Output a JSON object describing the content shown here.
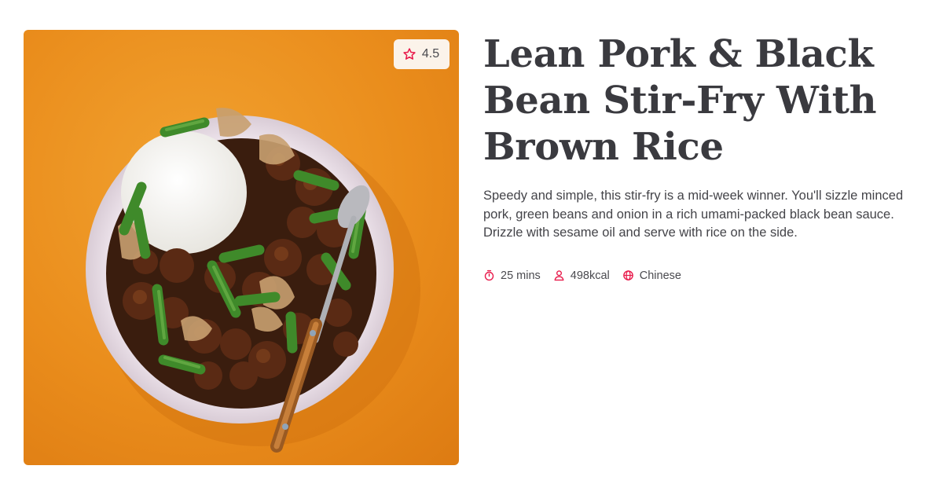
{
  "recipe": {
    "title": "Lean Pork & Black Bean Stir-Fry With Brown Rice",
    "description": "Speedy and simple, this stir-fry is a mid-week winner. You'll sizzle minced pork, green beans and onion in a rich umami-packed black bean sauce. Drizzle with sesame oil and serve with rice on the side.",
    "rating": "4.5",
    "image": {
      "alt": "Bowl of pork and black bean stir-fry with green beans and rice on an orange background"
    },
    "meta": [
      {
        "icon": "timer-icon",
        "label": "25 mins"
      },
      {
        "icon": "person-icon",
        "label": "498kcal"
      },
      {
        "icon": "globe-icon",
        "label": "Chinese"
      }
    ]
  },
  "colors": {
    "accent": "#e8194a",
    "background_orange": "#ea8d1c",
    "title": "#3a3a3f"
  }
}
